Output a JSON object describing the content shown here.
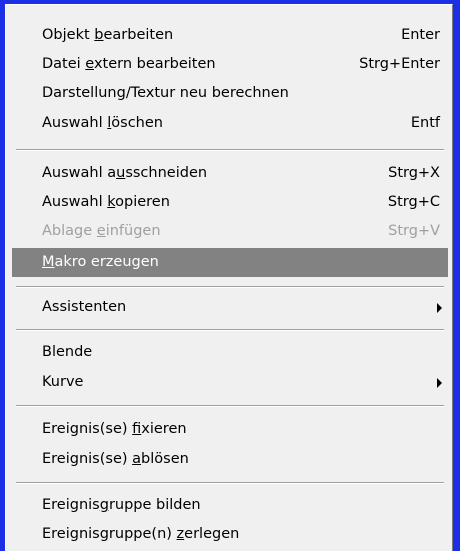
{
  "menu": {
    "items": [
      {
        "pre": "Objekt ",
        "u": "b",
        "post": "earbeiten",
        "shortcut": "Enter"
      },
      {
        "pre": "Datei ",
        "u": "e",
        "post": "xtern bearbeiten",
        "shortcut": "Strg+Enter"
      },
      {
        "pre": "Darstellung/Textur neu berechnen",
        "u": "",
        "post": "",
        "shortcut": ""
      },
      {
        "pre": "Auswahl ",
        "u": "l",
        "post": "öschen",
        "shortcut": "Entf"
      },
      {
        "pre": "Auswahl a",
        "u": "u",
        "post": "sschneiden",
        "shortcut": "Strg+X"
      },
      {
        "pre": "Auswahl ",
        "u": "k",
        "post": "opieren",
        "shortcut": "Strg+C"
      },
      {
        "pre": "Ablage ",
        "u": "e",
        "post": "infügen",
        "shortcut": "Strg+V"
      },
      {
        "pre": "",
        "u": "M",
        "post": "akro erzeugen",
        "shortcut": ""
      },
      {
        "pre": "Assistenten",
        "u": "",
        "post": "",
        "shortcut": ""
      },
      {
        "pre": "Blende",
        "u": "",
        "post": "",
        "shortcut": ""
      },
      {
        "pre": "Kurve",
        "u": "",
        "post": "",
        "shortcut": ""
      },
      {
        "pre": "Ereignis(se) ",
        "u": "f",
        "post": "ixieren",
        "shortcut": ""
      },
      {
        "pre": "Ereignis(se) ",
        "u": "a",
        "post": "blösen",
        "shortcut": ""
      },
      {
        "pre": "Ereignis",
        "u": "g",
        "post": "ruppe bilden",
        "shortcut": ""
      },
      {
        "pre": "Ereignisgruppe(n) ",
        "u": "z",
        "post": "erlegen",
        "shortcut": ""
      }
    ],
    "disabled_item": "Ablage einfügen",
    "highlighted_item": "Makro erzeugen",
    "submenu_items": [
      "Assistenten",
      "Kurve"
    ],
    "colors": {
      "frame": "#1d2fe6",
      "menu_background": "#f0f0f0",
      "highlight": "#828282",
      "disabled_text": "#a0a0a0"
    }
  }
}
